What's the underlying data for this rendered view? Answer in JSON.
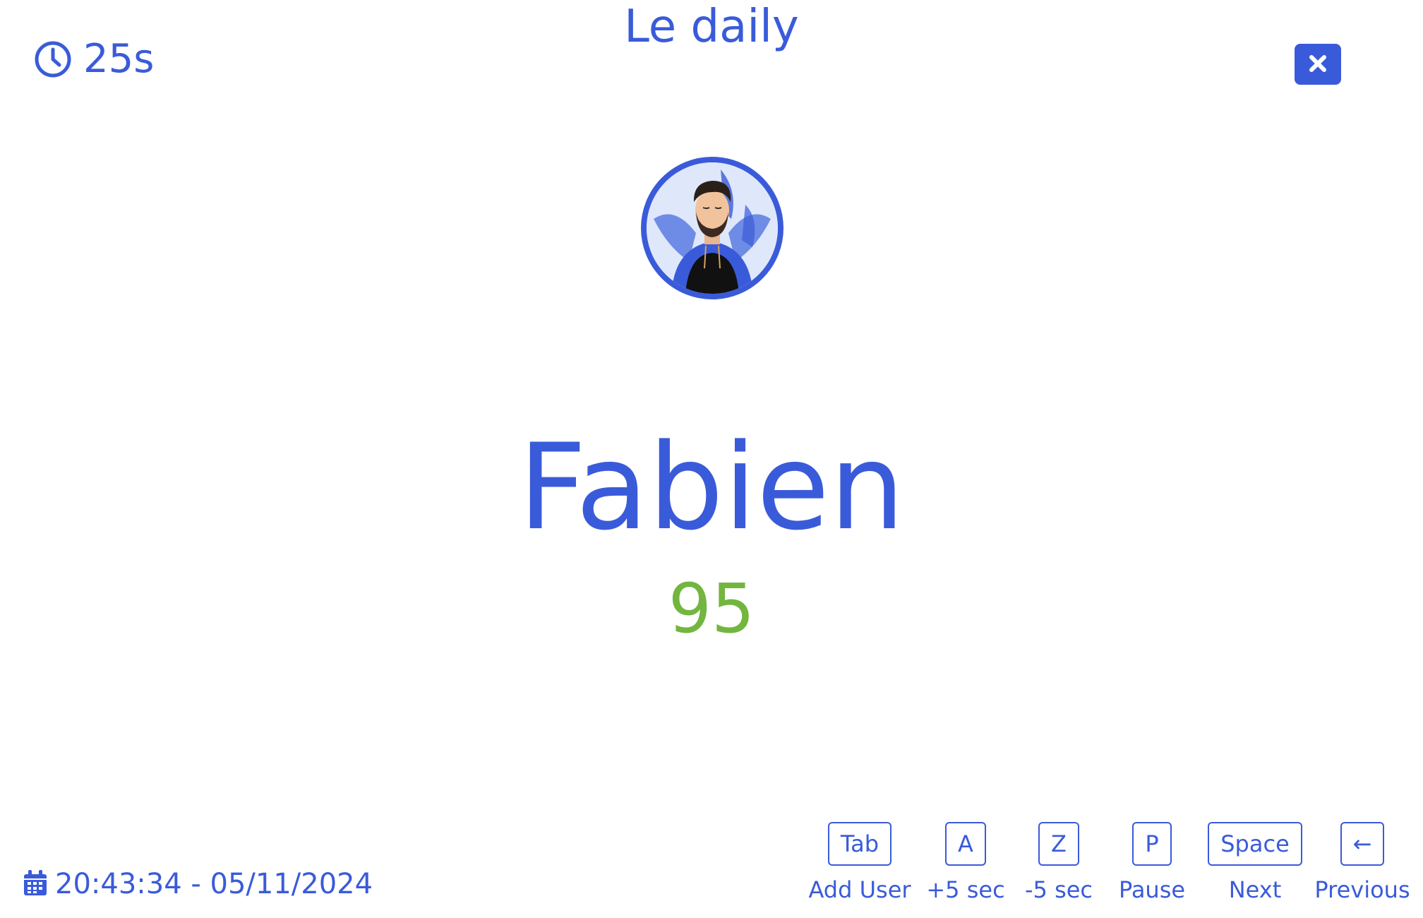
{
  "header": {
    "title": "Le daily",
    "timer": "25s",
    "close_icon": "close-icon"
  },
  "speaker": {
    "name": "Fabien",
    "score": "95",
    "avatar": "avatar-illustration"
  },
  "footer": {
    "datetime": "20:43:34 - 05/11/2024",
    "calendar_icon": "calendar-icon"
  },
  "shortcuts": [
    {
      "key": "Tab",
      "label": "Add User"
    },
    {
      "key": "A",
      "label": "+5 sec"
    },
    {
      "key": "Z",
      "label": "-5 sec"
    },
    {
      "key": "P",
      "label": "Pause"
    },
    {
      "key": "Space",
      "label": "Next"
    },
    {
      "key": "←",
      "label": "Previous"
    }
  ],
  "colors": {
    "primary": "#3a5bd9",
    "score": "#72b63f",
    "background": "#ffffff"
  }
}
